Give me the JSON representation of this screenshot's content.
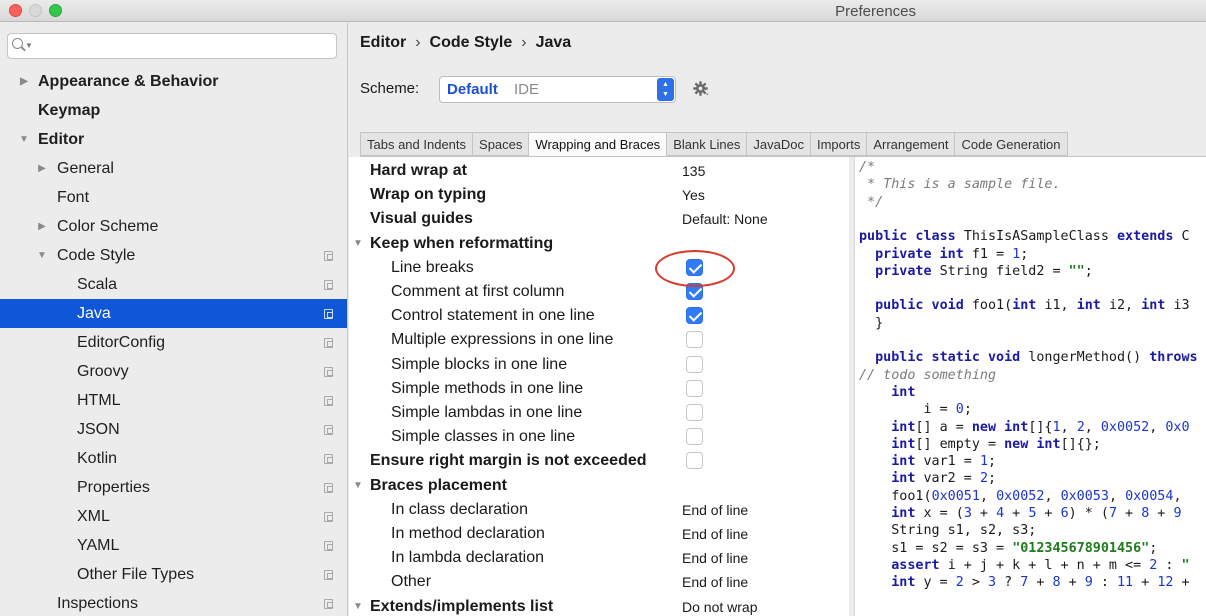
{
  "window": {
    "title": "Preferences",
    "controls": [
      "close",
      "minimize",
      "maximize"
    ]
  },
  "sidebar": {
    "search": {
      "value": "",
      "placeholder": ""
    },
    "items": [
      {
        "label": "Appearance & Behavior",
        "bold": true,
        "arrow": "collapsed",
        "indent": 0,
        "copy_icon": false
      },
      {
        "label": "Keymap",
        "bold": true,
        "arrow": null,
        "indent": 0,
        "copy_icon": false
      },
      {
        "label": "Editor",
        "bold": true,
        "arrow": "expanded",
        "indent": 0,
        "copy_icon": false
      },
      {
        "label": "General",
        "bold": false,
        "arrow": "collapsed",
        "indent": 1,
        "copy_icon": false
      },
      {
        "label": "Font",
        "bold": false,
        "arrow": null,
        "indent": 1,
        "copy_icon": false
      },
      {
        "label": "Color Scheme",
        "bold": false,
        "arrow": "collapsed",
        "indent": 1,
        "copy_icon": false
      },
      {
        "label": "Code Style",
        "bold": false,
        "arrow": "expanded",
        "indent": 1,
        "copy_icon": true
      },
      {
        "label": "Scala",
        "bold": false,
        "arrow": null,
        "indent": 2,
        "copy_icon": true
      },
      {
        "label": "Java",
        "bold": false,
        "arrow": null,
        "indent": 2,
        "copy_icon": true,
        "selected": true
      },
      {
        "label": "EditorConfig",
        "bold": false,
        "arrow": null,
        "indent": 2,
        "copy_icon": true
      },
      {
        "label": "Groovy",
        "bold": false,
        "arrow": null,
        "indent": 2,
        "copy_icon": true
      },
      {
        "label": "HTML",
        "bold": false,
        "arrow": null,
        "indent": 2,
        "copy_icon": true
      },
      {
        "label": "JSON",
        "bold": false,
        "arrow": null,
        "indent": 2,
        "copy_icon": true
      },
      {
        "label": "Kotlin",
        "bold": false,
        "arrow": null,
        "indent": 2,
        "copy_icon": true
      },
      {
        "label": "Properties",
        "bold": false,
        "arrow": null,
        "indent": 2,
        "copy_icon": true
      },
      {
        "label": "XML",
        "bold": false,
        "arrow": null,
        "indent": 2,
        "copy_icon": true
      },
      {
        "label": "YAML",
        "bold": false,
        "arrow": null,
        "indent": 2,
        "copy_icon": true
      },
      {
        "label": "Other File Types",
        "bold": false,
        "arrow": null,
        "indent": 2,
        "copy_icon": true
      },
      {
        "label": "Inspections",
        "bold": false,
        "arrow": null,
        "indent": 1,
        "copy_icon": true
      }
    ]
  },
  "main": {
    "breadcrumb": [
      "Editor",
      "Code Style",
      "Java"
    ],
    "breadcrumb_separator": "›",
    "scheme": {
      "label": "Scheme:",
      "name": "Default",
      "kind": "IDE"
    },
    "tabs": [
      {
        "label": "Tabs and Indents"
      },
      {
        "label": "Spaces"
      },
      {
        "label": "Wrapping and Braces",
        "active": true
      },
      {
        "label": "Blank Lines"
      },
      {
        "label": "JavaDoc"
      },
      {
        "label": "Imports"
      },
      {
        "label": "Arrangement"
      },
      {
        "label": "Code Generation"
      }
    ],
    "options": [
      {
        "label": "Hard wrap at",
        "group": true,
        "value": "135"
      },
      {
        "label": "Wrap on typing",
        "group": true,
        "value": "Yes"
      },
      {
        "label": "Visual guides",
        "group": true,
        "value": "Default: None"
      },
      {
        "label": "Keep when reformatting",
        "group": true,
        "collapsible": true
      },
      {
        "label": "Line breaks",
        "child": true,
        "checkbox": true,
        "checked": true,
        "highlighted": true
      },
      {
        "label": "Comment at first column",
        "child": true,
        "checkbox": true,
        "checked": true
      },
      {
        "label": "Control statement in one line",
        "child": true,
        "checkbox": true,
        "checked": true
      },
      {
        "label": "Multiple expressions in one line",
        "child": true,
        "checkbox": true,
        "checked": false
      },
      {
        "label": "Simple blocks in one line",
        "child": true,
        "checkbox": true,
        "checked": false
      },
      {
        "label": "Simple methods in one line",
        "child": true,
        "checkbox": true,
        "checked": false
      },
      {
        "label": "Simple lambdas in one line",
        "child": true,
        "checkbox": true,
        "checked": false
      },
      {
        "label": "Simple classes in one line",
        "child": true,
        "checkbox": true,
        "checked": false
      },
      {
        "label": "Ensure right margin is not exceeded",
        "group": true,
        "checkbox": true,
        "checked": false
      },
      {
        "label": "Braces placement",
        "group": true,
        "collapsible": true
      },
      {
        "label": "In class declaration",
        "child": true,
        "value": "End of line"
      },
      {
        "label": "In method declaration",
        "child": true,
        "value": "End of line"
      },
      {
        "label": "In lambda declaration",
        "child": true,
        "value": "End of line"
      },
      {
        "label": "Other",
        "child": true,
        "value": "End of line"
      },
      {
        "label": "Extends/implements list",
        "group": true,
        "collapsible": true,
        "value": "Do not wrap"
      }
    ]
  },
  "preview": {
    "lines": [
      [
        [
          "c-comment",
          "/*"
        ]
      ],
      [
        [
          "c-comment",
          " * This is a sample file."
        ]
      ],
      [
        [
          "c-comment",
          " */"
        ]
      ],
      [
        [
          "",
          ""
        ]
      ],
      [
        [
          "c-kw",
          "public class "
        ],
        [
          "",
          "ThisIsASampleClass "
        ],
        [
          "c-kw",
          "extends "
        ],
        [
          "",
          "C"
        ]
      ],
      [
        [
          "c-ws",
          "  "
        ],
        [
          "c-kw",
          "private int "
        ],
        [
          "",
          "f1 = "
        ],
        [
          "c-num",
          "1"
        ],
        [
          "",
          ";"
        ]
      ],
      [
        [
          "c-ws",
          "  "
        ],
        [
          "c-kw",
          "private "
        ],
        [
          "",
          "String field2 = "
        ],
        [
          "c-str",
          "\"\""
        ],
        [
          "",
          ";"
        ]
      ],
      [
        [
          "",
          ""
        ]
      ],
      [
        [
          "c-ws",
          "  "
        ],
        [
          "c-kw",
          "public void "
        ],
        [
          "",
          "foo1("
        ],
        [
          "c-kw",
          "int "
        ],
        [
          "",
          "i1, "
        ],
        [
          "c-kw",
          "int "
        ],
        [
          "",
          "i2, "
        ],
        [
          "c-kw",
          "int "
        ],
        [
          "",
          "i3"
        ]
      ],
      [
        [
          "c-ws",
          "  "
        ],
        [
          "",
          "}"
        ]
      ],
      [
        [
          "",
          ""
        ]
      ],
      [
        [
          "c-ws",
          "  "
        ],
        [
          "c-kw",
          "public static void "
        ],
        [
          "",
          "longerMethod() "
        ],
        [
          "c-kw",
          "throws"
        ]
      ],
      [
        [
          "c-comment",
          "// todo something"
        ]
      ],
      [
        [
          "c-ws",
          "    "
        ],
        [
          "c-kw",
          "int"
        ]
      ],
      [
        [
          "c-ws",
          "        "
        ],
        [
          "",
          "i = "
        ],
        [
          "c-num",
          "0"
        ],
        [
          "",
          ";"
        ]
      ],
      [
        [
          "c-ws",
          "    "
        ],
        [
          "c-kw",
          "int"
        ],
        [
          "",
          "[] a = "
        ],
        [
          "c-kw",
          "new int"
        ],
        [
          "",
          "[]{"
        ],
        [
          "c-num",
          "1"
        ],
        [
          "",
          ", "
        ],
        [
          "c-num",
          "2"
        ],
        [
          "",
          ", "
        ],
        [
          "c-num",
          "0x0052"
        ],
        [
          "",
          ", "
        ],
        [
          "c-num",
          "0x0"
        ]
      ],
      [
        [
          "c-ws",
          "    "
        ],
        [
          "c-kw",
          "int"
        ],
        [
          "",
          "[] empty = "
        ],
        [
          "c-kw",
          "new int"
        ],
        [
          "",
          "[]{};"
        ]
      ],
      [
        [
          "c-ws",
          "    "
        ],
        [
          "c-kw",
          "int "
        ],
        [
          "",
          "var1 = "
        ],
        [
          "c-num",
          "1"
        ],
        [
          "",
          ";"
        ]
      ],
      [
        [
          "c-ws",
          "    "
        ],
        [
          "c-kw",
          "int "
        ],
        [
          "",
          "var2 = "
        ],
        [
          "c-num",
          "2"
        ],
        [
          "",
          ";"
        ]
      ],
      [
        [
          "c-ws",
          "    "
        ],
        [
          "",
          "foo1("
        ],
        [
          "c-num",
          "0x0051"
        ],
        [
          "",
          ", "
        ],
        [
          "c-num",
          "0x0052"
        ],
        [
          "",
          ", "
        ],
        [
          "c-num",
          "0x0053"
        ],
        [
          "",
          ", "
        ],
        [
          "c-num",
          "0x0054"
        ],
        [
          "",
          ","
        ]
      ],
      [
        [
          "c-ws",
          "    "
        ],
        [
          "c-kw",
          "int "
        ],
        [
          "",
          "x = ("
        ],
        [
          "c-num",
          "3"
        ],
        [
          "",
          " + "
        ],
        [
          "c-num",
          "4"
        ],
        [
          "",
          " + "
        ],
        [
          "c-num",
          "5"
        ],
        [
          "",
          " + "
        ],
        [
          "c-num",
          "6"
        ],
        [
          "",
          ") * ("
        ],
        [
          "c-num",
          "7"
        ],
        [
          "",
          " + "
        ],
        [
          "c-num",
          "8"
        ],
        [
          "",
          " + "
        ],
        [
          "c-num",
          "9"
        ]
      ],
      [
        [
          "c-ws",
          "    "
        ],
        [
          "",
          "String s1, s2, s3;"
        ]
      ],
      [
        [
          "c-ws",
          "    "
        ],
        [
          "",
          "s1 = s2 = s3 = "
        ],
        [
          "c-str",
          "\"012345678901456\""
        ],
        [
          "",
          ";"
        ]
      ],
      [
        [
          "c-ws",
          "    "
        ],
        [
          "c-kw",
          "assert "
        ],
        [
          "",
          "i + j + k + l + n + m <= "
        ],
        [
          "c-num",
          "2"
        ],
        [
          "",
          " : "
        ],
        [
          "c-str",
          "\""
        ]
      ],
      [
        [
          "c-ws",
          "    "
        ],
        [
          "c-kw",
          "int "
        ],
        [
          "",
          "y = "
        ],
        [
          "c-num",
          "2"
        ],
        [
          "",
          " > "
        ],
        [
          "c-num",
          "3"
        ],
        [
          "",
          " ? "
        ],
        [
          "c-num",
          "7"
        ],
        [
          "",
          " + "
        ],
        [
          "c-num",
          "8"
        ],
        [
          "",
          " + "
        ],
        [
          "c-num",
          "9"
        ],
        [
          "",
          " : "
        ],
        [
          "c-num",
          "11"
        ],
        [
          "",
          " + "
        ],
        [
          "c-num",
          "12"
        ],
        [
          "",
          " +"
        ]
      ]
    ]
  },
  "colors": {
    "selection": "#0f57d7",
    "checkbox_checked": "#2f7cf6",
    "highlight_ellipse": "#d9382c",
    "keyword": "#1a1aa6",
    "string": "#1d7a1d"
  }
}
